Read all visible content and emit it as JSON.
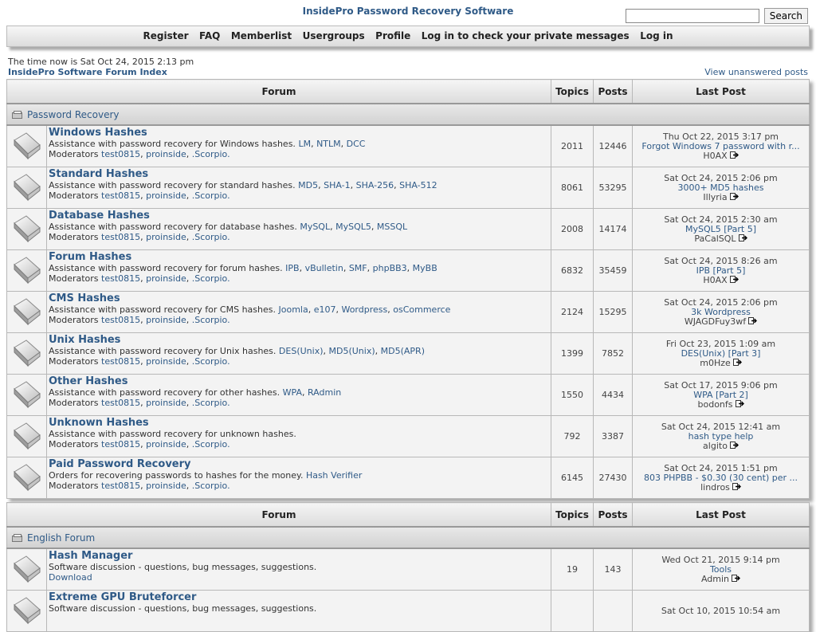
{
  "header": {
    "title": "InsidePro Password Recovery Software",
    "search_placeholder": "",
    "search_button": "Search"
  },
  "nav": [
    "Register",
    "FAQ",
    "Memberlist",
    "Usergroups",
    "Profile",
    "Log in to check your private messages",
    "Log in"
  ],
  "time_text": "The time now is Sat Oct 24, 2015 2:13 pm",
  "index_link": "InsidePro Software Forum Index",
  "unanswered_link": "View unanswered posts",
  "columns": {
    "forum": "Forum",
    "topics": "Topics",
    "posts": "Posts",
    "last": "Last Post"
  },
  "moderators_label": "Moderators",
  "moderators": [
    "test0815",
    "proinside",
    ".Scorpio."
  ],
  "sections": [
    {
      "name": "Password Recovery",
      "forums": [
        {
          "name": "Windows Hashes",
          "desc": "Assistance with password recovery for Windows hashes.",
          "tags": [
            "LM",
            "NTLM",
            "DCC"
          ],
          "mods": true,
          "topics": "2011",
          "posts": "12446",
          "last_date": "Thu Oct 22, 2015 3:17 pm",
          "last_title": "Forgot Windows 7 password with r...",
          "last_user": "H0AX"
        },
        {
          "name": "Standard Hashes",
          "desc": "Assistance with password recovery for standard hashes.",
          "tags": [
            "MD5",
            "SHA-1",
            "SHA-256",
            "SHA-512"
          ],
          "mods": true,
          "topics": "8061",
          "posts": "53295",
          "last_date": "Sat Oct 24, 2015 2:06 pm",
          "last_title": "3000+ MD5 hashes",
          "last_user": "Illyria"
        },
        {
          "name": "Database Hashes",
          "desc": "Assistance with password recovery for database hashes.",
          "tags": [
            "MySQL",
            "MySQL5",
            "MSSQL"
          ],
          "mods": true,
          "topics": "2008",
          "posts": "14174",
          "last_date": "Sat Oct 24, 2015 2:30 am",
          "last_title": "MySQL5 [Part 5]",
          "last_user": "PaCalSQL"
        },
        {
          "name": "Forum Hashes",
          "desc": "Assistance with password recovery for forum hashes.",
          "tags": [
            "IPB",
            "vBulletin",
            "SMF",
            "phpBB3",
            "MyBB"
          ],
          "mods": true,
          "topics": "6832",
          "posts": "35459",
          "last_date": "Sat Oct 24, 2015 8:26 am",
          "last_title": "IPB [Part 5]",
          "last_user": "H0AX"
        },
        {
          "name": "CMS Hashes",
          "desc": "Assistance with password recovery for CMS hashes.",
          "tags": [
            "Joomla",
            "e107",
            "Wordpress",
            "osCommerce"
          ],
          "mods": true,
          "topics": "2124",
          "posts": "15295",
          "last_date": "Sat Oct 24, 2015 2:06 pm",
          "last_title": "3k Wordpress",
          "last_user": "WJAGDFuy3wf"
        },
        {
          "name": "Unix Hashes",
          "desc": "Assistance with password recovery for Unix hashes.",
          "tags": [
            "DES(Unix)",
            "MD5(Unix)",
            "MD5(APR)"
          ],
          "mods": true,
          "topics": "1399",
          "posts": "7852",
          "last_date": "Fri Oct 23, 2015 1:09 am",
          "last_title": "DES(Unix) [Part 3]",
          "last_user": "m0Hze"
        },
        {
          "name": "Other Hashes",
          "desc": "Assistance with password recovery for other hashes.",
          "tags": [
            "WPA",
            "RAdmin"
          ],
          "mods": true,
          "topics": "1550",
          "posts": "4434",
          "last_date": "Sat Oct 17, 2015 9:06 pm",
          "last_title": "WPA [Part 2]",
          "last_user": "bodonfs"
        },
        {
          "name": "Unknown Hashes",
          "desc": "Assistance with password recovery for unknown hashes.",
          "tags": [],
          "mods": true,
          "topics": "792",
          "posts": "3387",
          "last_date": "Sat Oct 24, 2015 12:41 am",
          "last_title": "hash type help",
          "last_user": "algito"
        },
        {
          "name": "Paid Password Recovery",
          "desc": "Orders for recovering passwords to hashes for the money.",
          "tags": [
            "Hash Verifier"
          ],
          "mods": true,
          "topics": "6145",
          "posts": "27430",
          "last_date": "Sat Oct 24, 2015 1:51 pm",
          "last_title": "803 PHPBB - $0.30 (30 cent) per ...",
          "last_user": "lindros"
        }
      ]
    },
    {
      "name": "English Forum",
      "forums": [
        {
          "name": "Hash Manager",
          "desc": "Software discussion - questions, bug messages, suggestions.",
          "link_line": "Download",
          "mods": false,
          "topics": "19",
          "posts": "143",
          "last_date": "Wed Oct 21, 2015 9:14 pm",
          "last_title": "Tools",
          "last_user": "Admin"
        },
        {
          "name": "Extreme GPU Bruteforcer",
          "desc": "Software discussion - questions, bug messages, suggestions.",
          "link_line": "",
          "mods": false,
          "topics": "",
          "posts": "",
          "last_date": "Sat Oct 10, 2015 10:54 am",
          "last_title": "",
          "last_user": ""
        }
      ]
    }
  ],
  "colors": {
    "link": "#2f5a87",
    "border": "#b8b8b8",
    "row_bg": "#f3f3f3"
  },
  "icons": {
    "forum": "folder-read-icon",
    "category": "category-folder-icon",
    "last_post": "go-to-last-post-icon"
  }
}
